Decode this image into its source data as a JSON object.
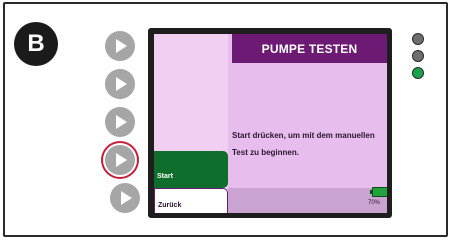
{
  "step": {
    "label": "B"
  },
  "screen": {
    "title": "PUMPE TESTEN",
    "instruction": "Start drücken, um mit dem manuellen Test zu beginnen.",
    "buttons": {
      "start": "Start",
      "back": "Zurück"
    },
    "battery": {
      "label": "70%",
      "level_percent": 70
    }
  },
  "indicators": [
    {
      "name": "led-1",
      "color": "#6e6e6e"
    },
    {
      "name": "led-2",
      "color": "#6e6e6e"
    },
    {
      "name": "led-3",
      "color": "#1aa34a"
    }
  ],
  "colors": {
    "header": "#6c1a73",
    "screen_bg": "#e6bdec",
    "start_button": "#0f6e2c",
    "active_softkey_ring": "#c2203a"
  }
}
